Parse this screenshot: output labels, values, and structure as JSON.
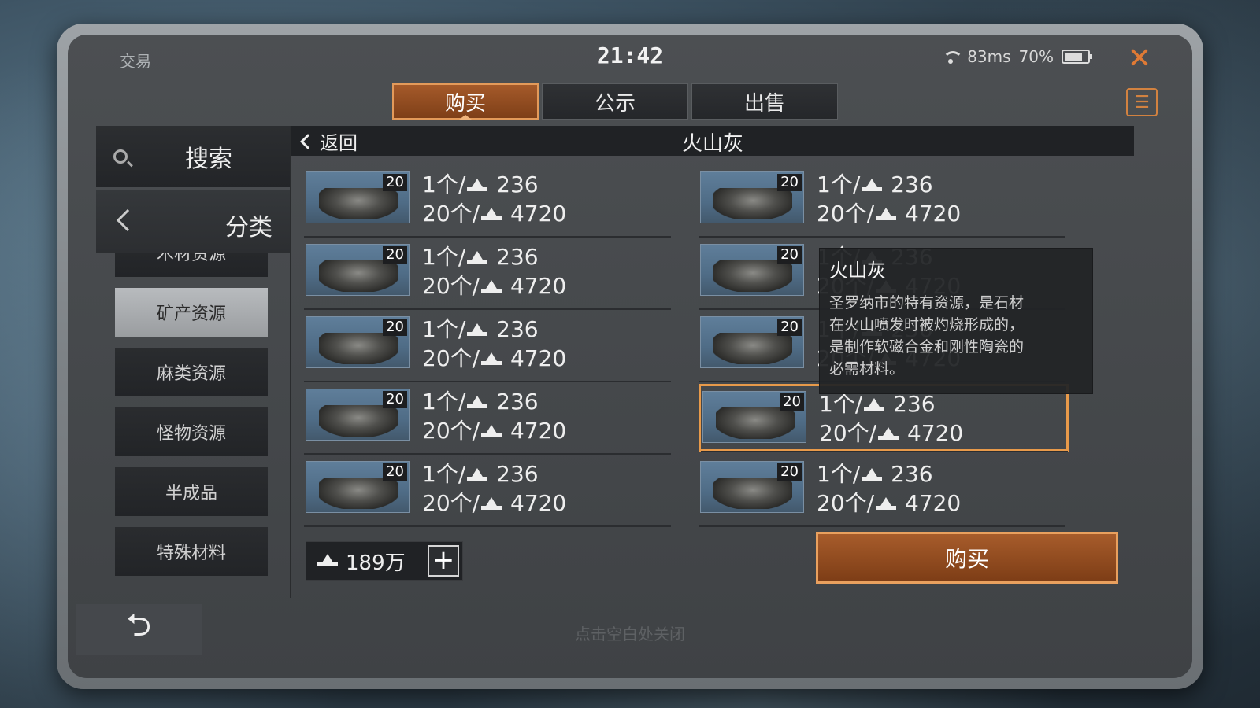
{
  "window": {
    "title": "交易",
    "clock": "21:42",
    "ping": "83ms",
    "battery": "70%"
  },
  "tabs": [
    {
      "label": "购买",
      "active": true
    },
    {
      "label": "公示",
      "active": false
    },
    {
      "label": "出售",
      "active": false
    }
  ],
  "sidebar": {
    "search_label": "搜索",
    "category_label": "分类",
    "categories": [
      {
        "label": "木材资源",
        "active": false
      },
      {
        "label": "矿产资源",
        "active": true
      },
      {
        "label": "麻类资源",
        "active": false
      },
      {
        "label": "怪物资源",
        "active": false
      },
      {
        "label": "半成品",
        "active": false
      },
      {
        "label": "特殊材料",
        "active": false
      }
    ]
  },
  "content": {
    "back_label": "返回",
    "item_title": "火山灰",
    "listings": [
      {
        "qty": "20",
        "unit_label": "1个/",
        "unit_price": "236",
        "bulk_label": "20个/",
        "bulk_price": "4720"
      },
      {
        "qty": "20",
        "unit_label": "1个/",
        "unit_price": "236",
        "bulk_label": "20个/",
        "bulk_price": "4720"
      },
      {
        "qty": "20",
        "unit_label": "1个/",
        "unit_price": "236",
        "bulk_label": "20个/",
        "bulk_price": "4720"
      },
      {
        "qty": "20",
        "unit_label": "1个/",
        "unit_price": "236",
        "bulk_label": "20个/",
        "bulk_price": "4720"
      },
      {
        "qty": "20",
        "unit_label": "1个/",
        "unit_price": "236",
        "bulk_label": "20个/",
        "bulk_price": "4720"
      },
      {
        "qty": "20",
        "unit_label": "1个/",
        "unit_price": "236",
        "bulk_label": "20个/",
        "bulk_price": "4720"
      },
      {
        "qty": "20",
        "unit_label": "1个/",
        "unit_price": "236",
        "bulk_label": "20个/",
        "bulk_price": "4720"
      },
      {
        "qty": "20",
        "unit_label": "1个/",
        "unit_price": "236",
        "bulk_label": "20个/",
        "bulk_price": "4720"
      },
      {
        "qty": "20",
        "unit_label": "1个/",
        "unit_price": "236",
        "bulk_label": "20个/",
        "bulk_price": "4720"
      },
      {
        "qty": "20",
        "unit_label": "1个/",
        "unit_price": "236",
        "bulk_label": "20个/",
        "bulk_price": "4720"
      }
    ],
    "tooltip": {
      "title": "火山灰",
      "lines": [
        "圣罗纳市的特有资源，是石材",
        "在火山喷发时被灼烧形成的，",
        "是制作软磁合金和刚性陶瓷的",
        "必需材料。"
      ]
    }
  },
  "footer": {
    "funds": "189万",
    "buy_label": "购买",
    "hint": "点击空白处关闭"
  },
  "colors": {
    "accent": "#e89a4a",
    "buy_button": "#a75c2b",
    "close": "#e07a35"
  }
}
